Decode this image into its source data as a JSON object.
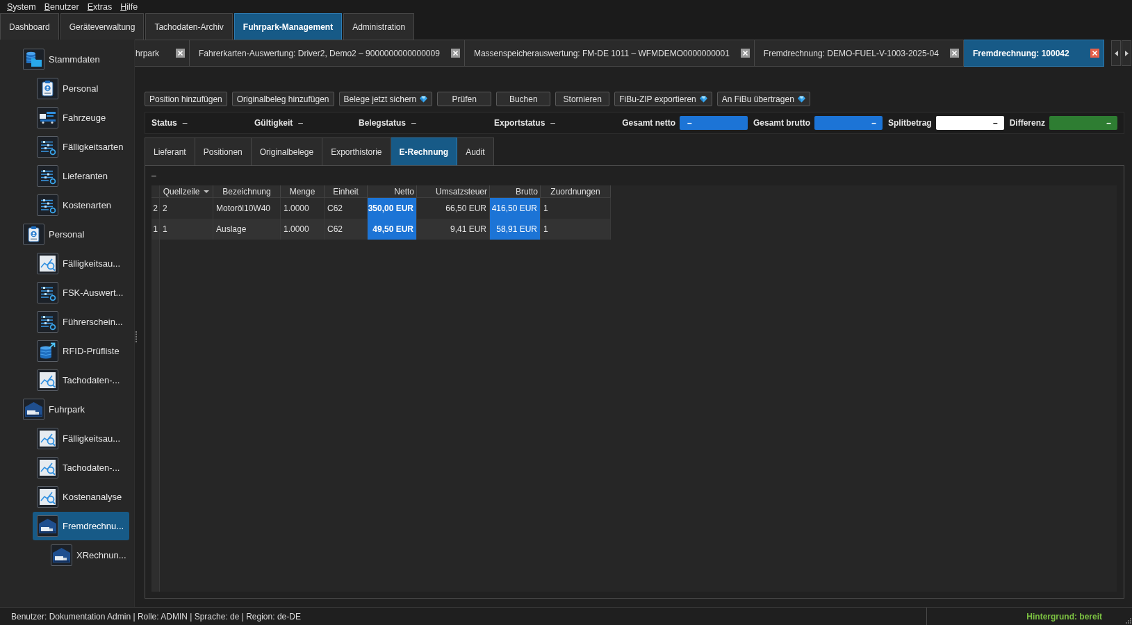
{
  "menu_bar": [
    "System",
    "Benutzer",
    "Extras",
    "Hilfe"
  ],
  "main_tabs": [
    {
      "label": "Dashboard",
      "selected": false
    },
    {
      "label": "Geräteverwaltung",
      "selected": false
    },
    {
      "label": "Tachodaten-Archiv",
      "selected": false
    },
    {
      "label": "Fuhrpark-Management",
      "selected": true
    },
    {
      "label": "Administration",
      "selected": false
    }
  ],
  "sidebar": {
    "items": [
      {
        "label": "Stammdaten",
        "kind": "data",
        "selected": false,
        "children": [
          {
            "label": "Personal",
            "kind": "staff",
            "selected": false
          },
          {
            "label": "Fahrzeuge",
            "kind": "vehicles",
            "selected": false
          },
          {
            "label": "Fälligkeitsarten",
            "kind": "list",
            "selected": false
          },
          {
            "label": "Lieferanten",
            "kind": "list",
            "selected": false
          },
          {
            "label": "Kostenarten",
            "kind": "list",
            "selected": false
          }
        ]
      },
      {
        "label": "Personal",
        "kind": "staff",
        "selected": false,
        "children": [
          {
            "label": "Fälligkeitsau...",
            "kind": "analysis",
            "selected": false
          },
          {
            "label": "FSK-Auswert...",
            "kind": "list",
            "selected": false
          },
          {
            "label": "Führerschein...",
            "kind": "list",
            "selected": false
          },
          {
            "label": "RFID-Prüfliste",
            "kind": "export",
            "selected": false
          },
          {
            "label": "Tachodaten-...",
            "kind": "analysis",
            "selected": false
          }
        ]
      },
      {
        "label": "Fuhrpark",
        "kind": "fleet",
        "selected": false,
        "children": [
          {
            "label": "Fälligkeitsau...",
            "kind": "analysis",
            "selected": false
          },
          {
            "label": "Tachodaten-...",
            "kind": "analysis",
            "selected": false
          },
          {
            "label": "Kostenanalyse",
            "kind": "analysis",
            "selected": false
          },
          {
            "label": "Fremdrechnu...",
            "kind": "fleet",
            "selected": true,
            "children": [
              {
                "label": "XRechnun...",
                "kind": "fleet",
                "selected": false
              }
            ]
          }
        ]
      }
    ]
  },
  "document_tabs": [
    {
      "label": "hrpark",
      "selected": false
    },
    {
      "label": "Fahrerkarten-Auswertung: Driver2, Demo2 – 9000000000000009",
      "selected": false
    },
    {
      "label": "Massenspeicherauswertung: FM-DE 1011 – WFMDEMO0000000001",
      "selected": false
    },
    {
      "label": "Fremdrechnung: DEMO-FUEL-V-1003-2025-04",
      "selected": false
    },
    {
      "label": "Fremdrechnung: 100042",
      "selected": true
    }
  ],
  "toolbar": {
    "buttons": [
      {
        "label": "Position hinzufügen",
        "premium": false
      },
      {
        "label": "Originalbeleg hinzufügen",
        "premium": false
      },
      {
        "label": "Belege jetzt sichern",
        "premium": true
      },
      {
        "label": "Prüfen",
        "premium": false
      },
      {
        "label": "Buchen",
        "premium": false
      },
      {
        "label": "Stornieren",
        "premium": false
      },
      {
        "label": "FiBu-ZIP exportieren",
        "premium": true
      },
      {
        "label": "An FiBu übertragen",
        "premium": true
      }
    ]
  },
  "status_panel": {
    "fields": [
      {
        "label": "Status",
        "value": "–"
      },
      {
        "label": "Gültigkeit",
        "value": "–"
      },
      {
        "label": "Belegstatus",
        "value": "–"
      },
      {
        "label": "Exportstatus",
        "value": "–"
      }
    ],
    "totals": [
      {
        "label": "Gesamt netto",
        "value": "–",
        "color": "#1c74d6"
      },
      {
        "label": "Gesamt brutto",
        "value": "–",
        "color": "#1c74d6"
      },
      {
        "label": "Splitbetrag",
        "value": "–",
        "color": "#ffffff"
      },
      {
        "label": "Differenz",
        "value": "–",
        "color": "#2e7d32"
      }
    ]
  },
  "detail_tabs": [
    {
      "label": "Lieferant",
      "selected": false
    },
    {
      "label": "Positionen",
      "selected": false
    },
    {
      "label": "Originalbelege",
      "selected": false
    },
    {
      "label": "Exporthistorie",
      "selected": false
    },
    {
      "label": "E-Rechnung",
      "selected": true
    },
    {
      "label": "Audit",
      "selected": false
    }
  ],
  "e_rechnung": {
    "caption": "–",
    "table": {
      "columns": [
        {
          "label": "Quellzeile",
          "kind": "text",
          "sorted": true,
          "highlighted": false,
          "emphasized": false
        },
        {
          "label": "Bezeichnung",
          "kind": "text",
          "sorted": false,
          "highlighted": false,
          "emphasized": false
        },
        {
          "label": "Menge",
          "kind": "text",
          "sorted": false,
          "highlighted": false,
          "emphasized": false
        },
        {
          "label": "Einheit",
          "kind": "text",
          "sorted": false,
          "highlighted": false,
          "emphasized": false
        },
        {
          "label": "Netto",
          "kind": "amount",
          "sorted": false,
          "highlighted": true,
          "emphasized": true
        },
        {
          "label": "Umsatzsteuer",
          "kind": "amount",
          "sorted": false,
          "highlighted": false,
          "emphasized": false
        },
        {
          "label": "Brutto",
          "kind": "amount",
          "sorted": false,
          "highlighted": true,
          "emphasized": false
        },
        {
          "label": "Zuordnungen",
          "kind": "text",
          "sorted": false,
          "highlighted": false,
          "emphasized": false
        }
      ],
      "rows": [
        {
          "row_number": "2",
          "cells": [
            "2",
            "Motoröl10W40",
            "1.0000",
            "C62",
            "350,00 EUR",
            "66,50 EUR",
            "416,50 EUR",
            "1"
          ]
        },
        {
          "row_number": "1",
          "cells": [
            "1",
            "Auslage",
            "1.0000",
            "C62",
            "49,50 EUR",
            "9,41 EUR",
            "58,91 EUR",
            "1"
          ]
        }
      ]
    }
  },
  "status_bar": {
    "session_info": "Benutzer: Dokumentation Admin | Rolle: ADMIN | Sprache: de | Region: de-DE",
    "background_status": "Hintergrund: bereit"
  }
}
